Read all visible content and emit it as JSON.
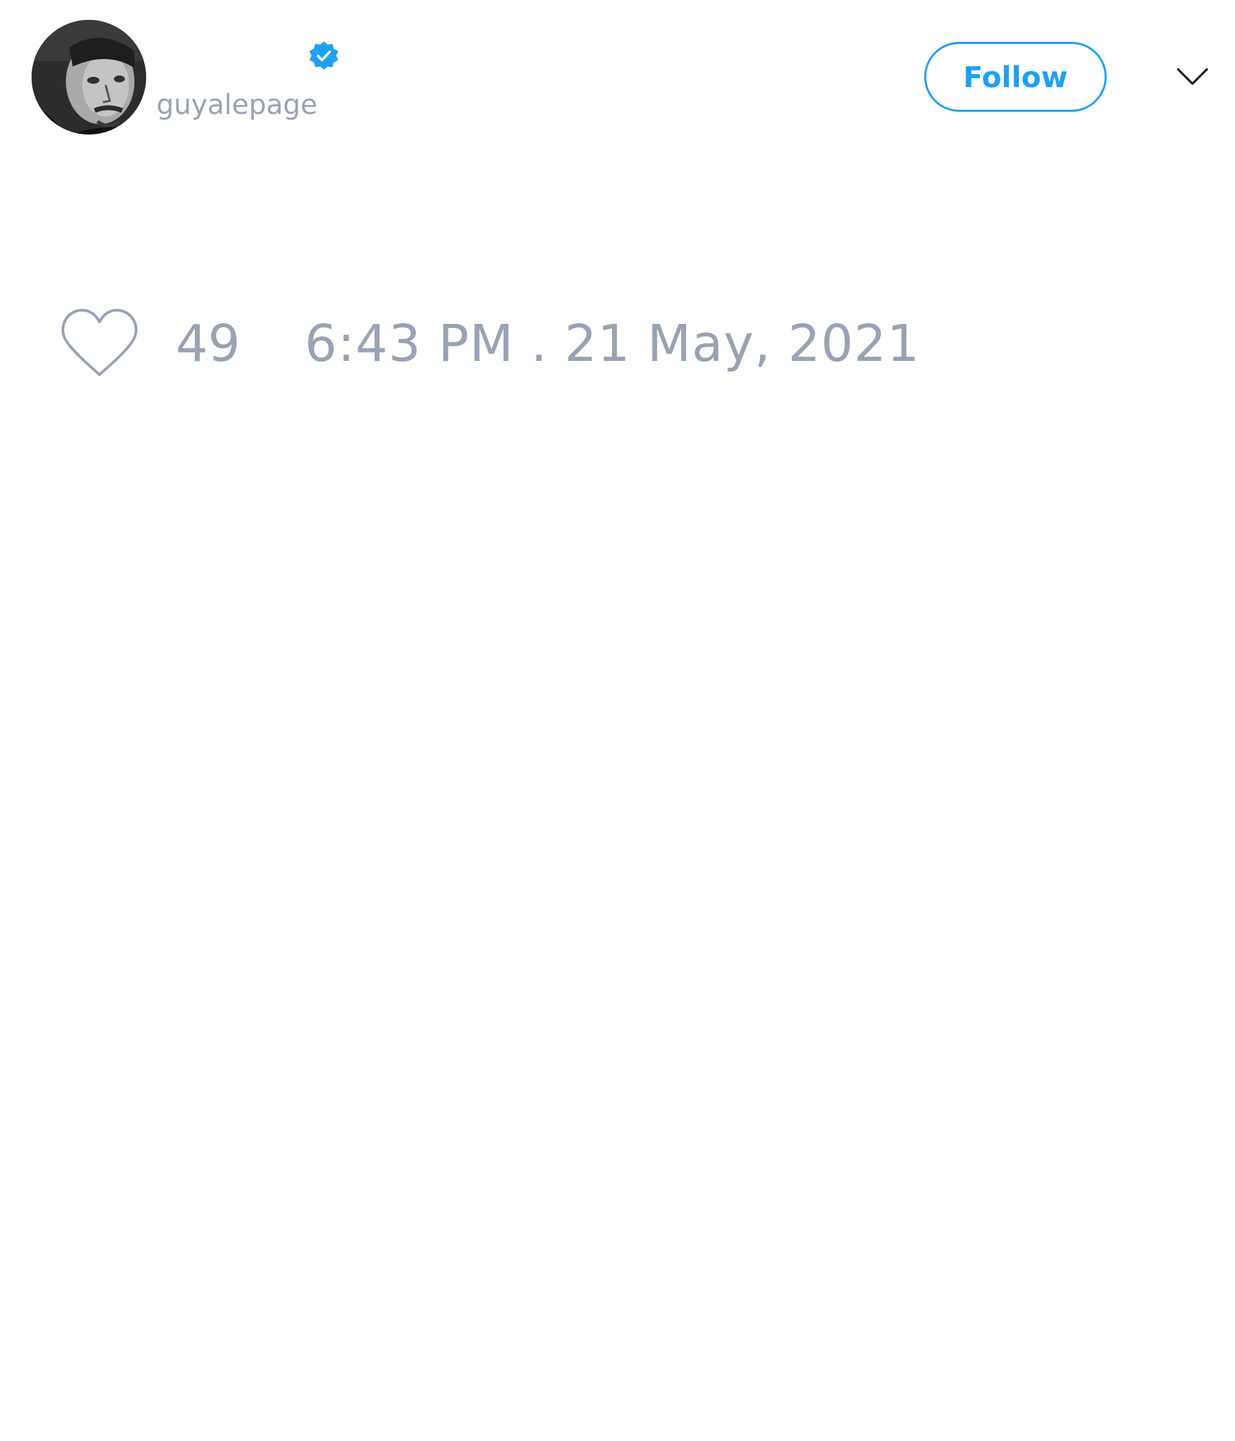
{
  "author": {
    "handle": "guyalepage",
    "verified": true,
    "avatar_icon": "person-photo-avatar"
  },
  "actions": {
    "follow_label": "Follow",
    "menu_icon": "chevron-down-icon"
  },
  "stats": {
    "like_icon": "heart-icon",
    "like_count": "49",
    "timestamp": "6:43 PM . 21 May, 2021"
  },
  "colors": {
    "accent": "#1da1f2",
    "muted_text": "#98a3b3",
    "background": "#ffffff"
  }
}
